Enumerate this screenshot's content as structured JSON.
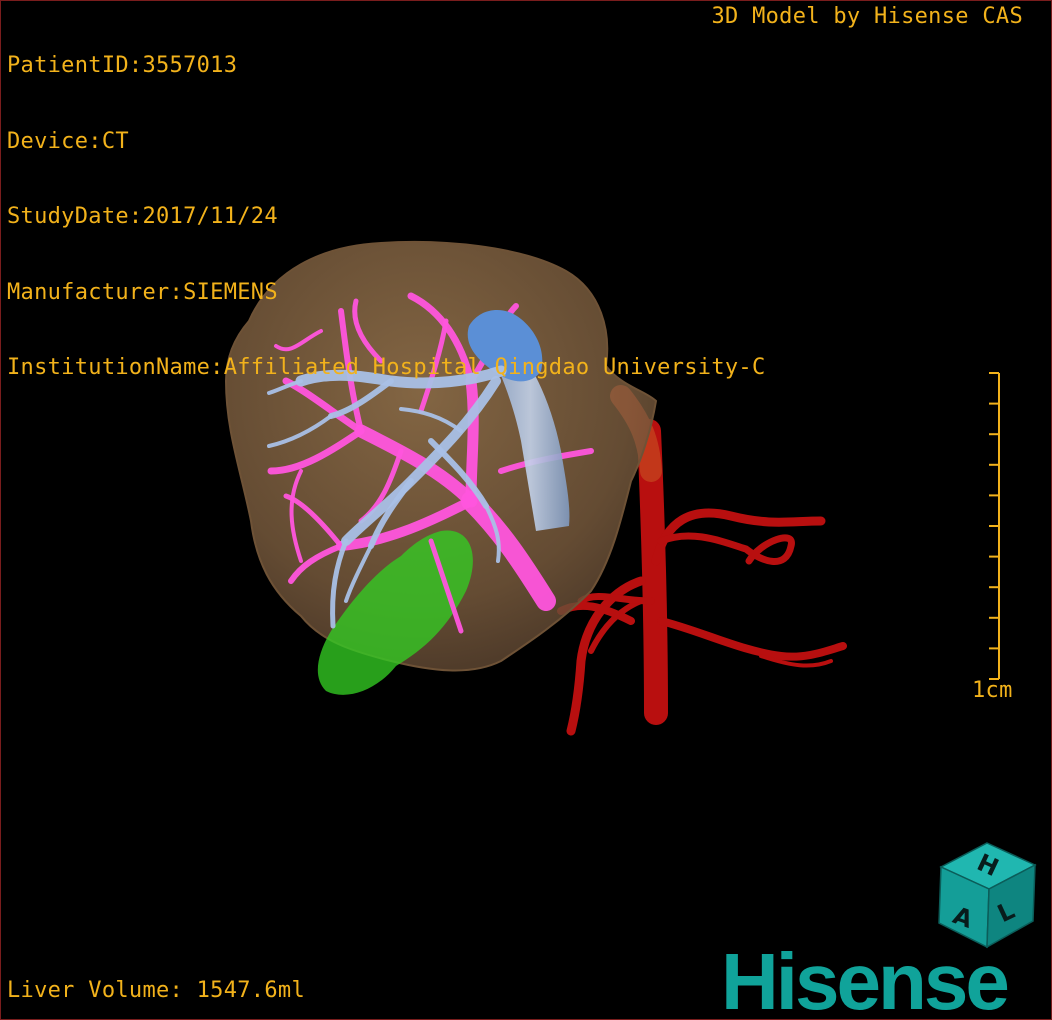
{
  "header": {
    "patient_id": "PatientID:3557013",
    "device": "Device:CT",
    "study_date": "StudyDate:2017/11/24",
    "manufacturer": "Manufacturer:SIEMENS",
    "institution": "InstitutionName:Affiliated Hospital Qingdao University-C",
    "credit": "3D Model by Hisense CAS"
  },
  "scale_bar": {
    "label": "1cm"
  },
  "footer": {
    "liver_volume": "Liver Volume: 1547.6ml"
  },
  "orientation_cube": {
    "letters": [
      "H",
      "A",
      "L"
    ]
  },
  "logo": {
    "text": "Hisense"
  },
  "colors": {
    "overlay_text": "#f2b21b",
    "liver": "#8a6a48",
    "portal_vein": "#ff55dd",
    "hepatic_vein": "#a9c0e6",
    "ivc": "#5b8fd6",
    "artery": "#b80f0f",
    "gallbladder": "#33cc22",
    "brand": "#10a39a"
  }
}
